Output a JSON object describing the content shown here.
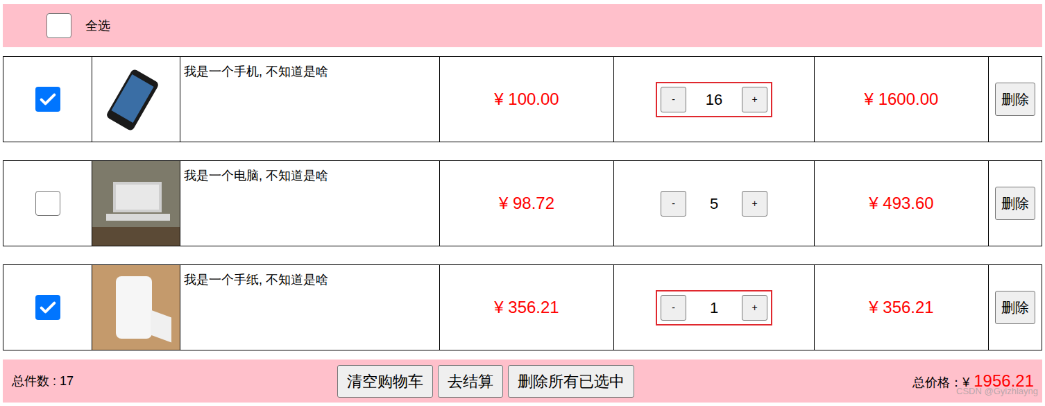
{
  "select_all": {
    "label": "全选",
    "checked": false
  },
  "items": [
    {
      "checked": true,
      "name": "我是一个手机, 不知道是啥",
      "price": "¥ 100.00",
      "minus": "-",
      "quantity": "16",
      "plus": "+",
      "subtotal": "¥ 1600.00",
      "delete": "删除"
    },
    {
      "checked": false,
      "name": "我是一个电脑, 不知道是啥",
      "price": "¥ 98.72",
      "minus": "-",
      "quantity": "5",
      "plus": "+",
      "subtotal": "¥ 493.60",
      "delete": "删除"
    },
    {
      "checked": true,
      "name": "我是一个手纸, 不知道是啥",
      "price": "¥ 356.21",
      "minus": "-",
      "quantity": "1",
      "plus": "+",
      "subtotal": "¥ 356.21",
      "delete": "删除"
    }
  ],
  "footer": {
    "count_label": "总件数 : 17",
    "buttons": [
      "清空购物车",
      "去结算",
      "删除所有已选中"
    ],
    "total_label": "总价格：¥",
    "total": "1956.21"
  },
  "watermark": "CSDN @Gyizhlayng"
}
